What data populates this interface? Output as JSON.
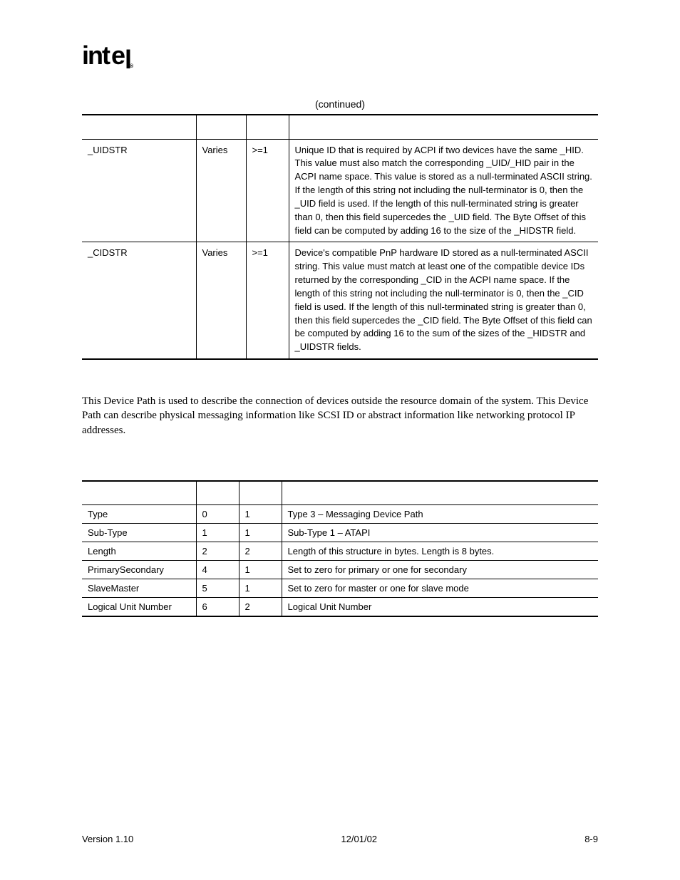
{
  "logo": "intel",
  "continued": "(continued)",
  "table1": {
    "headers": [
      "",
      "",
      "",
      ""
    ],
    "rows": [
      {
        "c0": "_UIDSTR",
        "c1": "Varies",
        "c2": ">=1",
        "c3": "Unique ID that is required by ACPI if two devices have the same _HID.  This value must also match the corresponding _UID/_HID pair in the ACPI name space.  This value is stored as a null-terminated ASCII string.  If the length of this string not including the null-terminator is 0, then the _UID field is used.  If the length of this null-terminated string is greater than 0, then this field supercedes the _UID field.  The Byte Offset of this field can be computed by adding 16 to the size of the _HIDSTR field."
      },
      {
        "c0": "_CIDSTR",
        "c1": "Varies",
        "c2": ">=1",
        "c3": "Device's compatible PnP hardware ID stored as a null-terminated ASCII string. This value must match at least one of the compatible device IDs returned by the corresponding _CID in the ACPI name space.  If the length of this string not including the null-terminator is 0, then the _CID field is used.  If the length of this null-terminated string is greater than 0, then this field supercedes the _CID field.  The Byte Offset of this field can be computed by adding 16 to the sum of the sizes of the _HIDSTR and _UIDSTR fields."
      }
    ]
  },
  "paragraph": "This Device Path is used to describe the connection of devices outside the resource domain of the system.  This Device Path can describe physical messaging information like SCSI ID or abstract information like networking protocol IP addresses.",
  "table2": {
    "headers": [
      "",
      "",
      "",
      ""
    ],
    "rows": [
      {
        "c0": "Type",
        "c1": "0",
        "c2": "1",
        "c3": "Type 3 – Messaging Device Path"
      },
      {
        "c0": "Sub-Type",
        "c1": "1",
        "c2": "1",
        "c3": "Sub-Type 1 – ATAPI"
      },
      {
        "c0": "Length",
        "c1": "2",
        "c2": "2",
        "c3": "Length of this structure in bytes.  Length is 8 bytes."
      },
      {
        "c0": "PrimarySecondary",
        "c1": "4",
        "c2": "1",
        "c3": "Set to zero for primary or one for secondary"
      },
      {
        "c0": "SlaveMaster",
        "c1": "5",
        "c2": "1",
        "c3": "Set to zero for master or one for slave mode"
      },
      {
        "c0": "Logical Unit Number",
        "c1": "6",
        "c2": "2",
        "c3": "Logical Unit Number"
      }
    ]
  },
  "footer": {
    "left": "Version 1.10",
    "center": "12/01/02",
    "right": "8-9"
  }
}
